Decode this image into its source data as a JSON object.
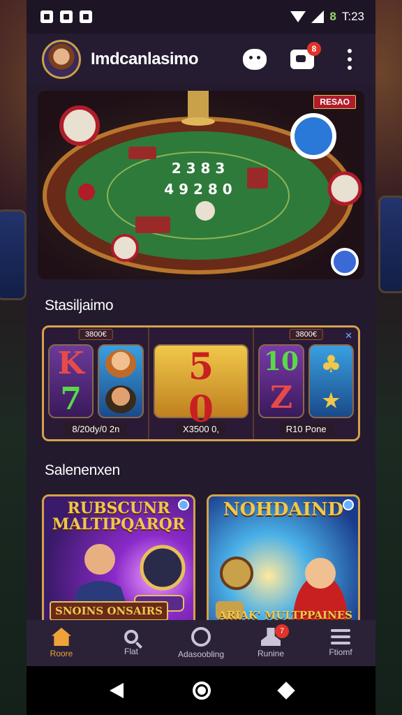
{
  "status_bar": {
    "battery": "8",
    "time": "T:23"
  },
  "app_bar": {
    "title": "Imdcanlasimo",
    "notification_count": "8"
  },
  "hero": {
    "tag": "RESAO",
    "table_numbers": [
      "2 3 8 3",
      "4 9 2 8 0"
    ]
  },
  "sections": {
    "slots_title": "Stasiljaimo",
    "games_title": "Salenenxen"
  },
  "slots": [
    {
      "cap": "3800€",
      "reels": [
        "K",
        "7"
      ],
      "footer": "8/20dy/0 2n"
    },
    {
      "cap": "",
      "reels": [
        "5",
        "0"
      ],
      "footer": "X3500 0,"
    },
    {
      "cap": "3800€",
      "reels": [
        "10",
        "Z"
      ],
      "footer": "R10 Pone"
    }
  ],
  "games": [
    {
      "name": "RUBSCUNR MALTIPQARQR",
      "sub": "SNOINS ONSAIRS"
    },
    {
      "name": "NOHDAIND",
      "sub": "ARIAK' MULTPPAINES"
    }
  ],
  "bottom_nav": [
    {
      "label": "Roore",
      "icon": "home-icon",
      "active": true
    },
    {
      "label": "Flat",
      "icon": "search-icon"
    },
    {
      "label": "Adasoobling",
      "icon": "tournament-icon"
    },
    {
      "label": "Runine",
      "icon": "user-icon",
      "badge": "7"
    },
    {
      "label": "Ftiomf",
      "icon": "menu-icon"
    }
  ],
  "colors": {
    "accent": "#f0a23a",
    "gold_border": "#d5a24b",
    "badge": "#e0332a",
    "surface": "#231a2e"
  }
}
